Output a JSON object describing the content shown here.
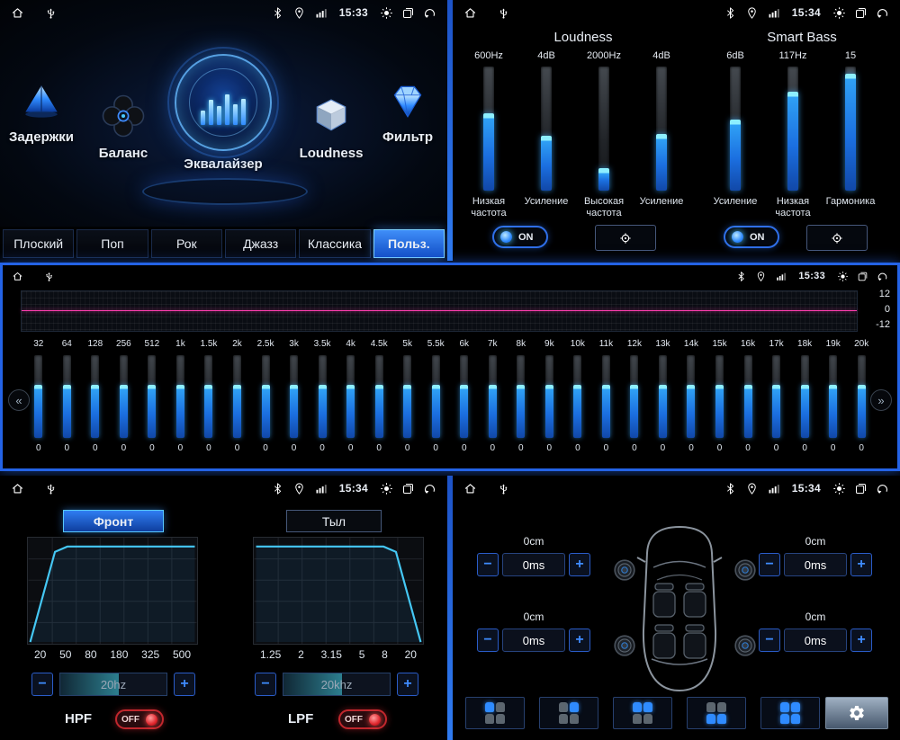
{
  "ui": {
    "minus": "−",
    "plus": "+",
    "prev": "«",
    "next": "»",
    "on": "ON",
    "off": "OFF"
  },
  "colors": {
    "accent": "#2463e6",
    "slider_fill": "#2fa0f5",
    "zero_line": "#ff3db0",
    "off_red": "#c1272d"
  },
  "status": {
    "tl_time": "15:33",
    "tr_time": "15:34",
    "mid_time": "15:33",
    "bl_time": "15:34",
    "br_time": "15:34"
  },
  "menu": {
    "items": [
      {
        "label": "Задержки"
      },
      {
        "label": "Баланс"
      },
      {
        "label": "Эквалайзер"
      },
      {
        "label": "Loudness"
      },
      {
        "label": "Фильтр"
      }
    ],
    "presets": [
      {
        "label": "Плоский",
        "active": ""
      },
      {
        "label": "Поп",
        "active": ""
      },
      {
        "label": "Рок",
        "active": ""
      },
      {
        "label": "Джазз",
        "active": ""
      },
      {
        "label": "Классика",
        "active": ""
      },
      {
        "label": "Польз.",
        "active": "active"
      }
    ]
  },
  "loudness": {
    "title": "Loudness",
    "smartbass_title": "Smart Bass",
    "sliders": [
      {
        "value": "600Hz",
        "label": "Низкая частота",
        "fill": 62
      },
      {
        "value": "4dB",
        "label": "Усиление",
        "fill": 44
      },
      {
        "value": "2000Hz",
        "label": "Высокая частота",
        "fill": 18
      },
      {
        "value": "4dB",
        "label": "Усиление",
        "fill": 46
      },
      {
        "value": "6dB",
        "label": "Усиление",
        "fill": 57
      },
      {
        "value": "117Hz",
        "label": "Низкая частота",
        "fill": 80
      },
      {
        "value": "15",
        "label": "Гармоника",
        "fill": 94
      }
    ]
  },
  "equalizer": {
    "scale": [
      "12",
      "0",
      "-12"
    ],
    "bands": [
      {
        "f": "32",
        "v": "0",
        "fill": 64
      },
      {
        "f": "64",
        "v": "0",
        "fill": 64
      },
      {
        "f": "128",
        "v": "0",
        "fill": 64
      },
      {
        "f": "256",
        "v": "0",
        "fill": 64
      },
      {
        "f": "512",
        "v": "0",
        "fill": 64
      },
      {
        "f": "1k",
        "v": "0",
        "fill": 64
      },
      {
        "f": "1.5k",
        "v": "0",
        "fill": 64
      },
      {
        "f": "2k",
        "v": "0",
        "fill": 64
      },
      {
        "f": "2.5k",
        "v": "0",
        "fill": 64
      },
      {
        "f": "3k",
        "v": "0",
        "fill": 64
      },
      {
        "f": "3.5k",
        "v": "0",
        "fill": 64
      },
      {
        "f": "4k",
        "v": "0",
        "fill": 64
      },
      {
        "f": "4.5k",
        "v": "0",
        "fill": 64
      },
      {
        "f": "5k",
        "v": "0",
        "fill": 64
      },
      {
        "f": "5.5k",
        "v": "0",
        "fill": 64
      },
      {
        "f": "6k",
        "v": "0",
        "fill": 64
      },
      {
        "f": "7k",
        "v": "0",
        "fill": 64
      },
      {
        "f": "8k",
        "v": "0",
        "fill": 64
      },
      {
        "f": "9k",
        "v": "0",
        "fill": 64
      },
      {
        "f": "10k",
        "v": "0",
        "fill": 64
      },
      {
        "f": "11k",
        "v": "0",
        "fill": 64
      },
      {
        "f": "12k",
        "v": "0",
        "fill": 64
      },
      {
        "f": "13k",
        "v": "0",
        "fill": 64
      },
      {
        "f": "14k",
        "v": "0",
        "fill": 64
      },
      {
        "f": "15k",
        "v": "0",
        "fill": 64
      },
      {
        "f": "16k",
        "v": "0",
        "fill": 64
      },
      {
        "f": "17k",
        "v": "0",
        "fill": 64
      },
      {
        "f": "18k",
        "v": "0",
        "fill": 64
      },
      {
        "f": "19k",
        "v": "0",
        "fill": 64
      },
      {
        "f": "20k",
        "v": "0",
        "fill": 64
      }
    ]
  },
  "filter": {
    "tabs": [
      {
        "label": "Фронт",
        "active": "active"
      },
      {
        "label": "Тыл",
        "active": ""
      }
    ],
    "hpf": {
      "label": "HPF",
      "value": "20hz",
      "freqs": [
        "20",
        "50",
        "80",
        "180",
        "325",
        "500"
      ],
      "fill": 55,
      "toggle": "OFF"
    },
    "lpf": {
      "label": "LPF",
      "value": "20khz",
      "freqs": [
        "1.25",
        "2",
        "3.15",
        "5",
        "8",
        "20"
      ],
      "fill": 55,
      "toggle": "OFF"
    }
  },
  "delay": {
    "corners": [
      {
        "cm": "0cm",
        "ms": "0ms"
      },
      {
        "cm": "0cm",
        "ms": "0ms"
      },
      {
        "cm": "0cm",
        "ms": "0ms"
      },
      {
        "cm": "0cm",
        "ms": "0ms"
      }
    ],
    "zones": [
      {
        "zone": "z-fl"
      },
      {
        "zone": "z-fr"
      },
      {
        "zone": "z-front"
      },
      {
        "zone": "z-rear"
      },
      {
        "zone": "z-all"
      }
    ]
  }
}
